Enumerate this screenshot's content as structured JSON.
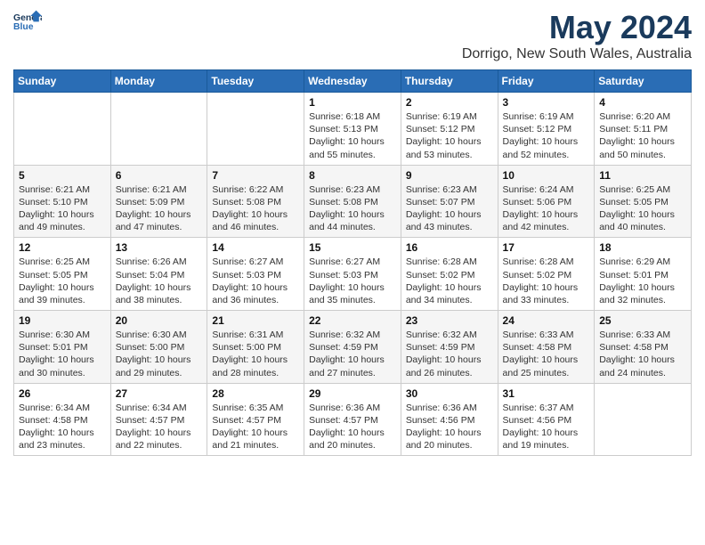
{
  "logo": {
    "line1": "General",
    "line2": "Blue"
  },
  "title": "May 2024",
  "subtitle": "Dorrigo, New South Wales, Australia",
  "header_row": [
    "Sunday",
    "Monday",
    "Tuesday",
    "Wednesday",
    "Thursday",
    "Friday",
    "Saturday"
  ],
  "weeks": [
    [
      {
        "day": "",
        "info": ""
      },
      {
        "day": "",
        "info": ""
      },
      {
        "day": "",
        "info": ""
      },
      {
        "day": "1",
        "info": "Sunrise: 6:18 AM\nSunset: 5:13 PM\nDaylight: 10 hours\nand 55 minutes."
      },
      {
        "day": "2",
        "info": "Sunrise: 6:19 AM\nSunset: 5:12 PM\nDaylight: 10 hours\nand 53 minutes."
      },
      {
        "day": "3",
        "info": "Sunrise: 6:19 AM\nSunset: 5:12 PM\nDaylight: 10 hours\nand 52 minutes."
      },
      {
        "day": "4",
        "info": "Sunrise: 6:20 AM\nSunset: 5:11 PM\nDaylight: 10 hours\nand 50 minutes."
      }
    ],
    [
      {
        "day": "5",
        "info": "Sunrise: 6:21 AM\nSunset: 5:10 PM\nDaylight: 10 hours\nand 49 minutes."
      },
      {
        "day": "6",
        "info": "Sunrise: 6:21 AM\nSunset: 5:09 PM\nDaylight: 10 hours\nand 47 minutes."
      },
      {
        "day": "7",
        "info": "Sunrise: 6:22 AM\nSunset: 5:08 PM\nDaylight: 10 hours\nand 46 minutes."
      },
      {
        "day": "8",
        "info": "Sunrise: 6:23 AM\nSunset: 5:08 PM\nDaylight: 10 hours\nand 44 minutes."
      },
      {
        "day": "9",
        "info": "Sunrise: 6:23 AM\nSunset: 5:07 PM\nDaylight: 10 hours\nand 43 minutes."
      },
      {
        "day": "10",
        "info": "Sunrise: 6:24 AM\nSunset: 5:06 PM\nDaylight: 10 hours\nand 42 minutes."
      },
      {
        "day": "11",
        "info": "Sunrise: 6:25 AM\nSunset: 5:05 PM\nDaylight: 10 hours\nand 40 minutes."
      }
    ],
    [
      {
        "day": "12",
        "info": "Sunrise: 6:25 AM\nSunset: 5:05 PM\nDaylight: 10 hours\nand 39 minutes."
      },
      {
        "day": "13",
        "info": "Sunrise: 6:26 AM\nSunset: 5:04 PM\nDaylight: 10 hours\nand 38 minutes."
      },
      {
        "day": "14",
        "info": "Sunrise: 6:27 AM\nSunset: 5:03 PM\nDaylight: 10 hours\nand 36 minutes."
      },
      {
        "day": "15",
        "info": "Sunrise: 6:27 AM\nSunset: 5:03 PM\nDaylight: 10 hours\nand 35 minutes."
      },
      {
        "day": "16",
        "info": "Sunrise: 6:28 AM\nSunset: 5:02 PM\nDaylight: 10 hours\nand 34 minutes."
      },
      {
        "day": "17",
        "info": "Sunrise: 6:28 AM\nSunset: 5:02 PM\nDaylight: 10 hours\nand 33 minutes."
      },
      {
        "day": "18",
        "info": "Sunrise: 6:29 AM\nSunset: 5:01 PM\nDaylight: 10 hours\nand 32 minutes."
      }
    ],
    [
      {
        "day": "19",
        "info": "Sunrise: 6:30 AM\nSunset: 5:01 PM\nDaylight: 10 hours\nand 30 minutes."
      },
      {
        "day": "20",
        "info": "Sunrise: 6:30 AM\nSunset: 5:00 PM\nDaylight: 10 hours\nand 29 minutes."
      },
      {
        "day": "21",
        "info": "Sunrise: 6:31 AM\nSunset: 5:00 PM\nDaylight: 10 hours\nand 28 minutes."
      },
      {
        "day": "22",
        "info": "Sunrise: 6:32 AM\nSunset: 4:59 PM\nDaylight: 10 hours\nand 27 minutes."
      },
      {
        "day": "23",
        "info": "Sunrise: 6:32 AM\nSunset: 4:59 PM\nDaylight: 10 hours\nand 26 minutes."
      },
      {
        "day": "24",
        "info": "Sunrise: 6:33 AM\nSunset: 4:58 PM\nDaylight: 10 hours\nand 25 minutes."
      },
      {
        "day": "25",
        "info": "Sunrise: 6:33 AM\nSunset: 4:58 PM\nDaylight: 10 hours\nand 24 minutes."
      }
    ],
    [
      {
        "day": "26",
        "info": "Sunrise: 6:34 AM\nSunset: 4:58 PM\nDaylight: 10 hours\nand 23 minutes."
      },
      {
        "day": "27",
        "info": "Sunrise: 6:34 AM\nSunset: 4:57 PM\nDaylight: 10 hours\nand 22 minutes."
      },
      {
        "day": "28",
        "info": "Sunrise: 6:35 AM\nSunset: 4:57 PM\nDaylight: 10 hours\nand 21 minutes."
      },
      {
        "day": "29",
        "info": "Sunrise: 6:36 AM\nSunset: 4:57 PM\nDaylight: 10 hours\nand 20 minutes."
      },
      {
        "day": "30",
        "info": "Sunrise: 6:36 AM\nSunset: 4:56 PM\nDaylight: 10 hours\nand 20 minutes."
      },
      {
        "day": "31",
        "info": "Sunrise: 6:37 AM\nSunset: 4:56 PM\nDaylight: 10 hours\nand 19 minutes."
      },
      {
        "day": "",
        "info": ""
      }
    ]
  ]
}
